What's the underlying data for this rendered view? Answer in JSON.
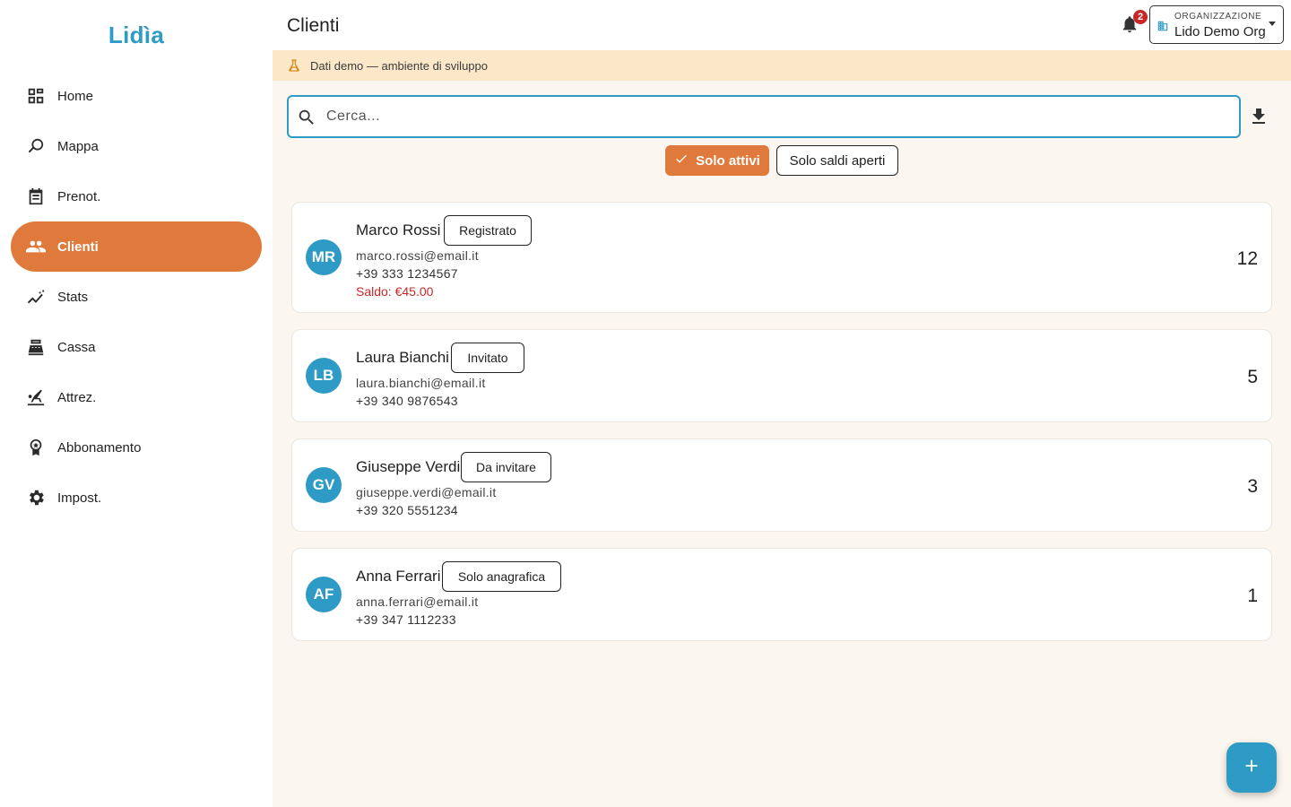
{
  "app": {
    "logo": "Lidìa"
  },
  "sidebar": {
    "items": [
      {
        "label": "Home",
        "icon": "dashboard-icon"
      },
      {
        "label": "Mappa",
        "icon": "map-pin-icon"
      },
      {
        "label": "Prenot.",
        "icon": "calendar-list-icon"
      },
      {
        "label": "Clienti",
        "icon": "people-icon",
        "active": true
      },
      {
        "label": "Stats",
        "icon": "trend-line-icon"
      },
      {
        "label": "Cassa",
        "icon": "cash-register-icon"
      },
      {
        "label": "Attrez.",
        "icon": "beach-chair-icon"
      },
      {
        "label": "Abbonamento",
        "icon": "badge-ribbon-icon"
      },
      {
        "label": "Impost.",
        "icon": "gear-icon"
      }
    ]
  },
  "header": {
    "title": "Clienti",
    "notifications_count": "2",
    "org_caption": "ORGANIZZAZIONE",
    "org_value": "Lido Demo Org"
  },
  "banner": {
    "text": "Dati demo — ambiente di sviluppo"
  },
  "search": {
    "placeholder": "Cerca..."
  },
  "filters": {
    "active_label": "Solo attivi",
    "open_balance_label": "Solo saldi aperti"
  },
  "clients": [
    {
      "initials": "MR",
      "name": "Marco Rossi",
      "status": "Registrato",
      "email": "marco.rossi@email.it",
      "phone": "+39 333 1234567",
      "balance": "Saldo: €45.00",
      "count": "12"
    },
    {
      "initials": "LB",
      "name": "Laura Bianchi",
      "status": "Invitato",
      "email": "laura.bianchi@email.it",
      "phone": "+39 340 9876543",
      "balance": "",
      "count": "5"
    },
    {
      "initials": "GV",
      "name": "Giuseppe Verdi",
      "status": "Da invitare",
      "email": "giuseppe.verdi@email.it",
      "phone": "+39 320 5551234",
      "balance": "",
      "count": "3"
    },
    {
      "initials": "AF",
      "name": "Anna Ferrari",
      "status": "Solo anagrafica",
      "email": "anna.ferrari@email.it",
      "phone": "+39 347 1112233",
      "balance": "",
      "count": "1"
    }
  ],
  "colors": {
    "accent": "#e07a3c",
    "brand": "#2e9bc6",
    "banner": "#fce8c8",
    "balance": "#c62828"
  }
}
